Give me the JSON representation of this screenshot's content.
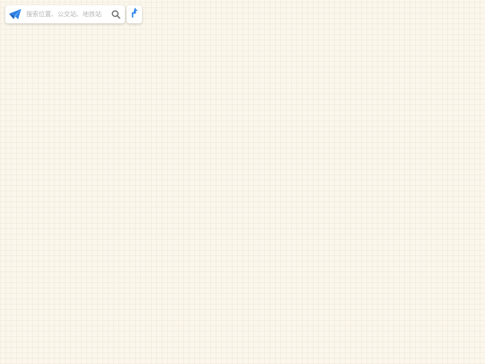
{
  "search": {
    "placeholder": "搜索位置、公交站、地铁站"
  },
  "icons": {
    "logo": "paper-plane-icon",
    "search": "search-icon",
    "route": "route-direction-icon"
  },
  "colors": {
    "map_background": "#fbf7ec",
    "logo_blue": "#2f7fe5",
    "logo_light_blue": "#5fb0f5",
    "route_blue": "#2f87e8"
  }
}
